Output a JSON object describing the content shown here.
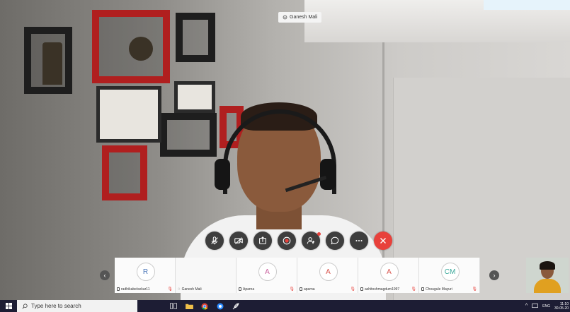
{
  "video": {
    "speaker_name": "Ganesh Mali"
  },
  "controls": [
    {
      "name": "mute-button",
      "icon": "microphone-off-icon"
    },
    {
      "name": "camera-button",
      "icon": "camera-off-icon"
    },
    {
      "name": "share-button",
      "icon": "share-screen-icon"
    },
    {
      "name": "record-button",
      "icon": "record-icon"
    },
    {
      "name": "participants-button",
      "icon": "participants-icon"
    },
    {
      "name": "chat-button",
      "icon": "chat-icon"
    },
    {
      "name": "more-button",
      "icon": "more-icon"
    },
    {
      "name": "end-call-button",
      "icon": "end-call-icon"
    }
  ],
  "participants": [
    {
      "initials": "R",
      "name": "radhikabelsekar11",
      "muted": true,
      "color": "#4a76b8"
    },
    {
      "initials": "",
      "name": "Ganesh Mali",
      "muted": false,
      "color": "#333333"
    },
    {
      "initials": "A",
      "name": "Aparna",
      "muted": true,
      "color": "#c95f9d"
    },
    {
      "initials": "A",
      "name": "aparna",
      "muted": true,
      "color": "#d9544d"
    },
    {
      "initials": "A",
      "name": "ashitoshmagdum1997",
      "muted": true,
      "color": "#d9544d"
    },
    {
      "initials": "CM",
      "name": "Chougule Mayuri",
      "muted": true,
      "color": "#3aa89a"
    }
  ],
  "taskbar": {
    "search_placeholder": "Type here to search",
    "language": "ENG",
    "time": "11:10",
    "date": "30-05-20"
  },
  "colors": {
    "end_call": "#e8413b",
    "control_bg": "#3e3e3e",
    "taskbar_bg": "#1d1d34"
  }
}
